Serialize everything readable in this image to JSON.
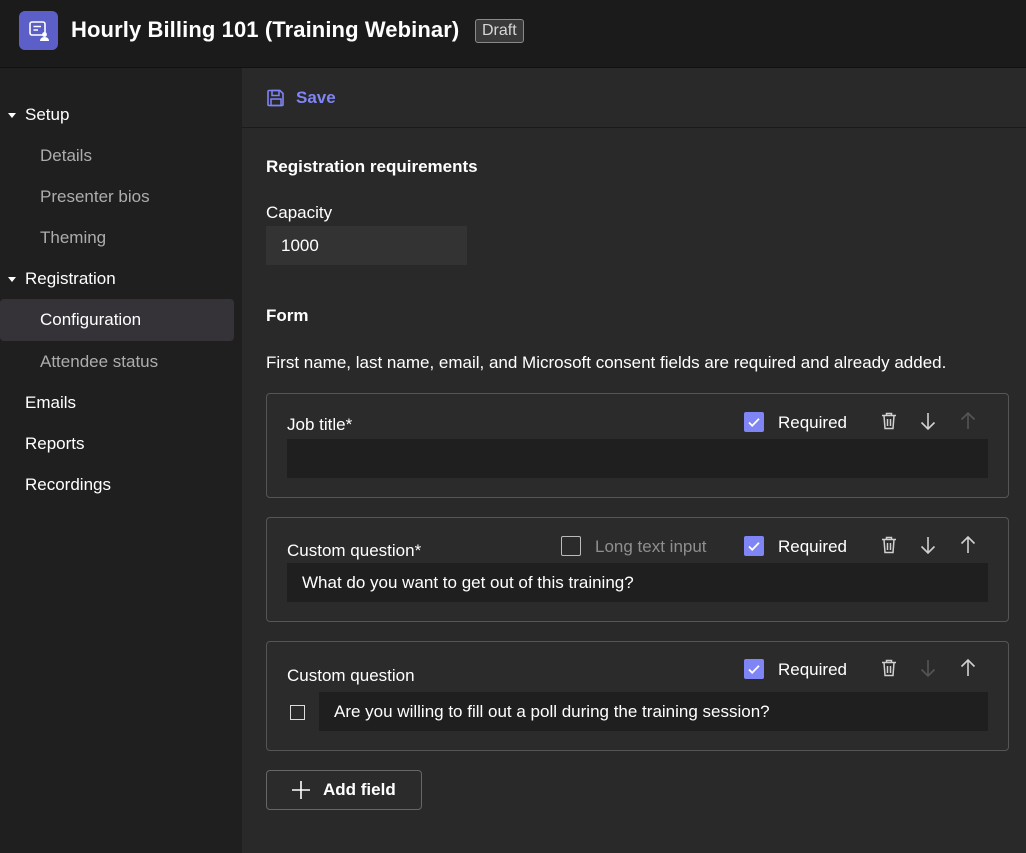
{
  "header": {
    "app_icon": "event-chat-icon",
    "title": "Hourly Billing 101 (Training Webinar)",
    "badge": "Draft"
  },
  "sidebar": {
    "items": [
      {
        "label": "Setup",
        "type": "section",
        "expanded": true
      },
      {
        "label": "Details",
        "type": "sub"
      },
      {
        "label": "Presenter bios",
        "type": "sub"
      },
      {
        "label": "Theming",
        "type": "sub"
      },
      {
        "label": "Registration",
        "type": "section",
        "expanded": true
      },
      {
        "label": "Configuration",
        "type": "sub",
        "active": true
      },
      {
        "label": "Attendee status",
        "type": "sub"
      },
      {
        "label": "Emails",
        "type": "top"
      },
      {
        "label": "Reports",
        "type": "top"
      },
      {
        "label": "Recordings",
        "type": "top"
      }
    ]
  },
  "toolbar": {
    "save_label": "Save",
    "save_icon": "save-icon"
  },
  "main": {
    "registration_title": "Registration requirements",
    "capacity_label": "Capacity",
    "capacity_value": "1000",
    "form_title": "Form",
    "form_helper": "First name, last name, email, and Microsoft consent fields are required and already added.",
    "fields": [
      {
        "label": "Job title*",
        "value": "",
        "required_label": "Required",
        "required": true,
        "can_move_down": true,
        "can_move_up": false
      },
      {
        "label": "Custom question*",
        "value": "What do you want to get out of this training?",
        "long_text_label": "Long text input",
        "long_text": false,
        "required_label": "Required",
        "required": true,
        "can_move_down": true,
        "can_move_up": true
      },
      {
        "label": "Custom question",
        "value": "Are you willing to fill out a poll during the training session?",
        "checkbox_type": true,
        "required_label": "Required",
        "required": true,
        "can_move_down": false,
        "can_move_up": true
      }
    ],
    "add_field_label": "Add field"
  },
  "colors": {
    "accent": "#7f85f5",
    "brand": "#5b5fc7",
    "background": "#292929",
    "sidebar": "#1f1f1f"
  }
}
